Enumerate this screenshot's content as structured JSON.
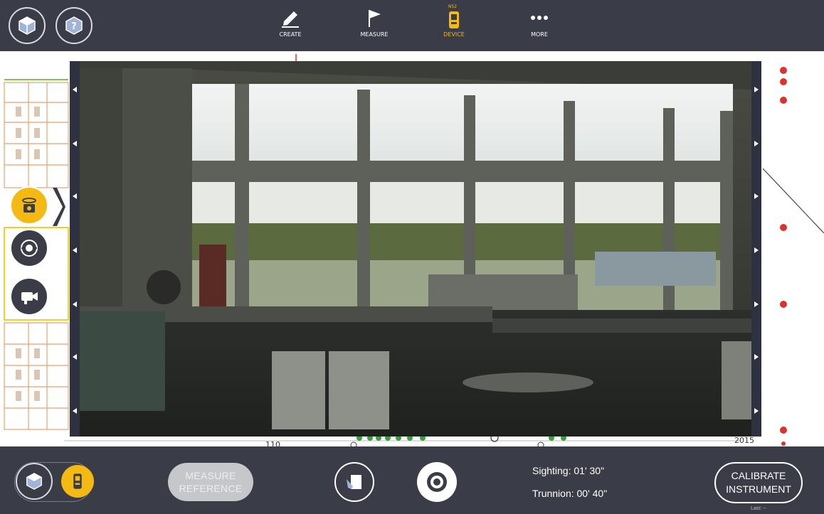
{
  "toolbar": {
    "tools": [
      {
        "label": "CREATE",
        "icon": "pencil-icon"
      },
      {
        "label": "MEASURE",
        "icon": "flag-icon"
      },
      {
        "label": "DEVICE",
        "icon": "device-icon"
      },
      {
        "label": "MORE",
        "icon": "more-dots-icon"
      }
    ],
    "device_badge": "N52"
  },
  "plan_labels": {
    "grid_110": "110",
    "grid_2015": "2015"
  },
  "bottom": {
    "measure_reference": [
      "MEASURE",
      "REFERENCE"
    ],
    "sighting": "Sighting: 01' 30\"",
    "trunnion": "Trunnion: 00' 40\"",
    "calibrate": [
      "CALIBRATE",
      "INSTRUMENT"
    ],
    "last": "Last: --"
  },
  "colors": {
    "bar": "#3a3c47",
    "accent": "#f5b914",
    "plan_red": "#e0302a"
  }
}
